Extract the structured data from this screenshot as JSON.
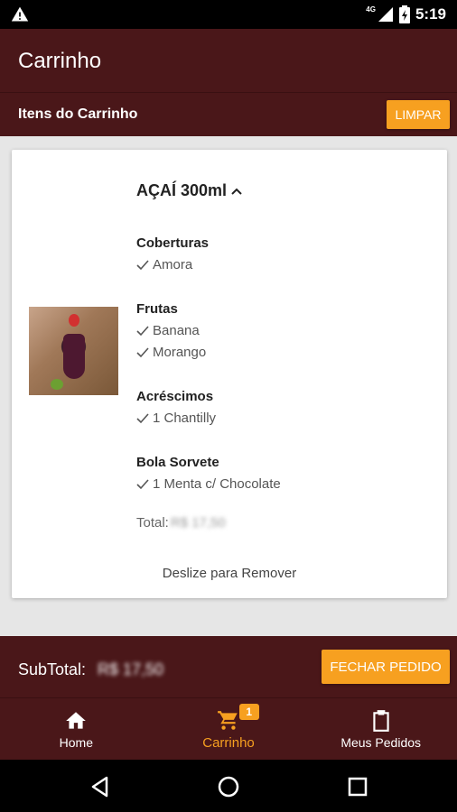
{
  "status_bar": {
    "network": "4G",
    "time": "5:19"
  },
  "app_bar": {
    "title": "Carrinho"
  },
  "cart_header": {
    "title": "Itens do Carrinho",
    "clear_label": "LIMPAR"
  },
  "item": {
    "name": "AÇAÍ 300ml",
    "groups": [
      {
        "title": "Coberturas",
        "options": [
          "Amora"
        ]
      },
      {
        "title": "Frutas",
        "options": [
          "Banana",
          "Morango"
        ]
      },
      {
        "title": "Acréscimos",
        "options": [
          "1 Chantilly"
        ]
      },
      {
        "title": "Bola Sorvete",
        "options": [
          "1 Menta c/ Chocolate"
        ]
      }
    ],
    "total_label": "Total:",
    "total_value": "R$ 17,50",
    "swipe_hint": "Deslize para Remover"
  },
  "footer": {
    "subtotal_label": "SubTotal:",
    "subtotal_value": "R$ 17,50",
    "checkout_label": "FECHAR PEDIDO"
  },
  "bottom_nav": {
    "items": [
      {
        "label": "Home",
        "icon": "home-icon"
      },
      {
        "label": "Carrinho",
        "icon": "cart-icon",
        "badge": "1",
        "active": true
      },
      {
        "label": "Meus Pedidos",
        "icon": "clipboard-icon"
      }
    ]
  },
  "colors": {
    "primary": "#4a1719",
    "accent": "#f7a020",
    "background": "#e6e6e6"
  }
}
